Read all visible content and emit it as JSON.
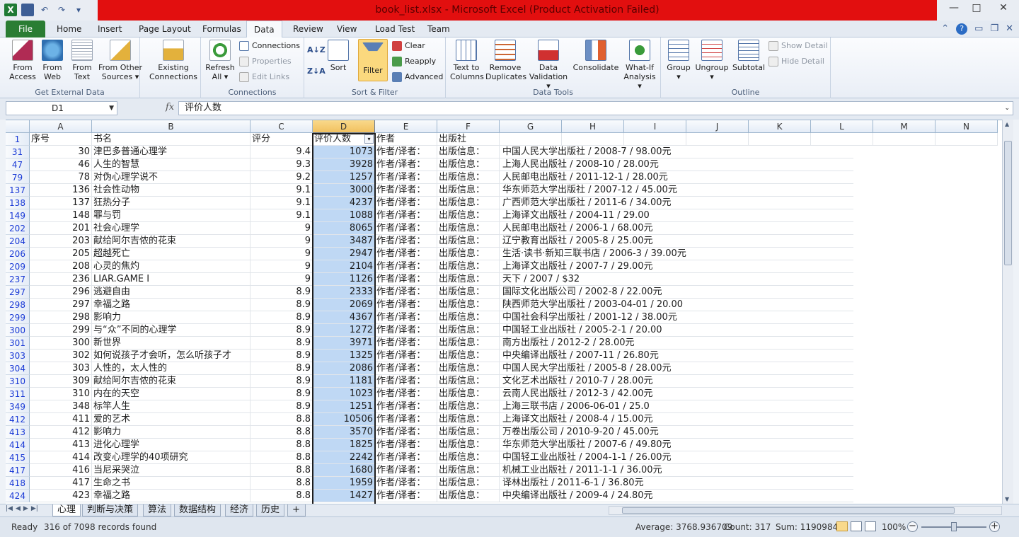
{
  "window": {
    "title": "book_list.xlsx  -  Microsoft Excel (Product Activation Failed)"
  },
  "qat": {
    "logo": "X",
    "save": "💾",
    "undo": "↶",
    "redo": "↷",
    "more": "▾"
  },
  "window_controls": {
    "minimize": "—",
    "maximize": "□",
    "close": "✕"
  },
  "tabs": [
    "File",
    "Home",
    "Insert",
    "Page Layout",
    "Formulas",
    "Data",
    "Review",
    "View",
    "Load Test",
    "Team"
  ],
  "active_tab": "Data",
  "ribbon": {
    "get_external": {
      "label": "Get External Data",
      "from_access": "From\nAccess",
      "from_web": "From\nWeb",
      "from_text": "From\nText",
      "from_other": "From Other\nSources ▾",
      "existing": "Existing\nConnections"
    },
    "connections": {
      "label": "Connections",
      "refresh": "Refresh\nAll ▾",
      "connections": "Connections",
      "properties": "Properties",
      "edit_links": "Edit Links"
    },
    "sort_filter": {
      "label": "Sort & Filter",
      "sort": "Sort",
      "filter": "Filter",
      "clear": "Clear",
      "reapply": "Reapply",
      "advanced": "Advanced"
    },
    "data_tools": {
      "label": "Data Tools",
      "text_to_columns": "Text to\nColumns",
      "remove_duplicates": "Remove\nDuplicates",
      "data_validation": "Data\nValidation ▾",
      "consolidate": "Consolidate",
      "what_if": "What-If\nAnalysis ▾"
    },
    "outline": {
      "label": "Outline",
      "group": "Group\n▾",
      "ungroup": "Ungroup\n▾",
      "subtotal": "Subtotal",
      "show_detail": "Show Detail",
      "hide_detail": "Hide Detail"
    }
  },
  "formula_bar": {
    "name_box": "D1",
    "fx": "fx",
    "formula": "评价人数"
  },
  "columns": [
    "A",
    "B",
    "C",
    "D",
    "E",
    "F",
    "G",
    "H",
    "I",
    "J",
    "K",
    "L",
    "M",
    "N"
  ],
  "header_row": {
    "row_number": "1",
    "a": "序号",
    "b": "书名",
    "c": "评分",
    "d": "评价人数",
    "e": "作者",
    "f": "出版社"
  },
  "rows": [
    {
      "r": "31",
      "a": "30",
      "b": "津巴多普通心理学",
      "c": "9.4",
      "d": "1073",
      "e": "作者/译者：",
      "f": "出版信息：",
      "g": "中国人民大学出版社 / 2008-7 / 98.00元"
    },
    {
      "r": "47",
      "a": "46",
      "b": "人生的智慧",
      "c": "9.3",
      "d": "3928",
      "e": "作者/译者：",
      "f": "出版信息：",
      "g": "上海人民出版社 / 2008-10 / 28.00元"
    },
    {
      "r": "79",
      "a": "78",
      "b": "对伪心理学说不",
      "c": "9.2",
      "d": "1257",
      "e": "作者/译者：",
      "f": "出版信息：",
      "g": "人民邮电出版社 / 2011-12-1 / 28.00元"
    },
    {
      "r": "137",
      "a": "136",
      "b": "社会性动物",
      "c": "9.1",
      "d": "3000",
      "e": "作者/译者：",
      "f": "出版信息：",
      "g": "华东师范大学出版社 / 2007-12 / 45.00元"
    },
    {
      "r": "138",
      "a": "137",
      "b": "狂热分子",
      "c": "9.1",
      "d": "4237",
      "e": "作者/译者：",
      "f": "出版信息：",
      "g": "广西师范大学出版社 / 2011-6 / 34.00元"
    },
    {
      "r": "149",
      "a": "148",
      "b": "罪与罚",
      "c": "9.1",
      "d": "1088",
      "e": "作者/译者：",
      "f": "出版信息：",
      "g": "上海译文出版社 / 2004-11 / 29.00"
    },
    {
      "r": "202",
      "a": "201",
      "b": "社会心理学",
      "c": "9",
      "d": "8065",
      "e": "作者/译者：",
      "f": "出版信息：",
      "g": "人民邮电出版社 / 2006-1 / 68.00元"
    },
    {
      "r": "204",
      "a": "203",
      "b": "献给阿尔吉侬的花束",
      "c": "9",
      "d": "3487",
      "e": "作者/译者：",
      "f": "出版信息：",
      "g": "辽宁教育出版社 / 2005-8 / 25.00元"
    },
    {
      "r": "206",
      "a": "205",
      "b": "超越死亡",
      "c": "9",
      "d": "2947",
      "e": "作者/译者：",
      "f": "出版信息：",
      "g": "生活·读书·新知三联书店 / 2006-3 / 39.00元"
    },
    {
      "r": "209",
      "a": "208",
      "b": "心灵的焦灼",
      "c": "9",
      "d": "2104",
      "e": "作者/译者：",
      "f": "出版信息：",
      "g": "上海译文出版社 / 2007-7 / 29.00元"
    },
    {
      "r": "237",
      "a": "236",
      "b": "LIAR.GAME Ⅰ",
      "c": "9",
      "d": "1126",
      "e": "作者/译者：",
      "f": "出版信息：",
      "g": "天下 / 2007 / $32"
    },
    {
      "r": "297",
      "a": "296",
      "b": "逃避自由",
      "c": "8.9",
      "d": "2333",
      "e": "作者/译者：",
      "f": "出版信息：",
      "g": "国际文化出版公司 / 2002-8 / 22.00元"
    },
    {
      "r": "298",
      "a": "297",
      "b": "幸福之路",
      "c": "8.9",
      "d": "2069",
      "e": "作者/译者：",
      "f": "出版信息：",
      "g": "陕西师范大学出版社 / 2003-04-01 / 20.00"
    },
    {
      "r": "299",
      "a": "298",
      "b": "影响力",
      "c": "8.9",
      "d": "4367",
      "e": "作者/译者：",
      "f": "出版信息：",
      "g": "中国社会科学出版社 / 2001-12 / 38.00元"
    },
    {
      "r": "300",
      "a": "299",
      "b": "与“众”不同的心理学",
      "c": "8.9",
      "d": "1272",
      "e": "作者/译者：",
      "f": "出版信息：",
      "g": "中国轻工业出版社 / 2005-2-1 / 20.00"
    },
    {
      "r": "301",
      "a": "300",
      "b": "新世界",
      "c": "8.9",
      "d": "3971",
      "e": "作者/译者：",
      "f": "出版信息：",
      "g": "南方出版社 / 2012-2 / 28.00元"
    },
    {
      "r": "303",
      "a": "302",
      "b": "如何说孩子才会听，怎么听孩子才",
      "c": "8.9",
      "d": "1325",
      "e": "作者/译者：",
      "f": "出版信息：",
      "g": "中央编译出版社 / 2007-11 / 26.80元"
    },
    {
      "r": "304",
      "a": "303",
      "b": "人性的，太人性的",
      "c": "8.9",
      "d": "2086",
      "e": "作者/译者：",
      "f": "出版信息：",
      "g": "中国人民大学出版社 / 2005-8 / 28.00元"
    },
    {
      "r": "310",
      "a": "309",
      "b": "献给阿尔吉侬的花束",
      "c": "8.9",
      "d": "1181",
      "e": "作者/译者：",
      "f": "出版信息：",
      "g": "文化艺术出版社 / 2010-7 / 28.00元"
    },
    {
      "r": "311",
      "a": "310",
      "b": "内在的天空",
      "c": "8.9",
      "d": "1023",
      "e": "作者/译者：",
      "f": "出版信息：",
      "g": "云南人民出版社 / 2012-3 / 42.00元"
    },
    {
      "r": "349",
      "a": "348",
      "b": "标竿人生",
      "c": "8.9",
      "d": "1251",
      "e": "作者/译者：",
      "f": "出版信息：",
      "g": "上海三联书店 / 2006-06-01 / 25.0"
    },
    {
      "r": "412",
      "a": "411",
      "b": "爱的艺术",
      "c": "8.8",
      "d": "10506",
      "e": "作者/译者：",
      "f": "出版信息：",
      "g": "上海译文出版社 / 2008-4 / 15.00元"
    },
    {
      "r": "413",
      "a": "412",
      "b": "影响力",
      "c": "8.8",
      "d": "3570",
      "e": "作者/译者：",
      "f": "出版信息：",
      "g": "万卷出版公司 / 2010-9-20 / 45.00元"
    },
    {
      "r": "414",
      "a": "413",
      "b": "进化心理学",
      "c": "8.8",
      "d": "1825",
      "e": "作者/译者：",
      "f": "出版信息：",
      "g": "华东师范大学出版社 / 2007-6 / 49.80元"
    },
    {
      "r": "415",
      "a": "414",
      "b": "改变心理学的40项研究",
      "c": "8.8",
      "d": "2242",
      "e": "作者/译者：",
      "f": "出版信息：",
      "g": "中国轻工业出版社 / 2004-1-1 / 26.00元"
    },
    {
      "r": "417",
      "a": "416",
      "b": "当尼采哭泣",
      "c": "8.8",
      "d": "1680",
      "e": "作者/译者：",
      "f": "出版信息：",
      "g": "机械工业出版社 / 2011-1-1 / 36.00元"
    },
    {
      "r": "418",
      "a": "417",
      "b": "生命之书",
      "c": "8.8",
      "d": "1959",
      "e": "作者/译者：",
      "f": "出版信息：",
      "g": "译林出版社 / 2011-6-1 / 36.80元"
    },
    {
      "r": "424",
      "a": "423",
      "b": "幸福之路",
      "c": "8.8",
      "d": "1427",
      "e": "作者/译者：",
      "f": "出版信息：",
      "g": "中央编译出版社 / 2009-4 / 24.80元"
    }
  ],
  "sheets": [
    "心理",
    "判断与决策",
    "算法",
    "数据结构",
    "经济",
    "历史"
  ],
  "active_sheet": "心理",
  "status": {
    "ready": "Ready",
    "records": "316 of 7098 records found",
    "average": "Average: 3768.936709",
    "count": "Count: 317",
    "sum": "Sum: 1190984",
    "zoom": "100%"
  },
  "colors": {
    "title_red": "#e20f0f",
    "file_green": "#2a7d33",
    "selection_blue": "#bfd8f4",
    "header_highlight": "#f1c15f"
  }
}
